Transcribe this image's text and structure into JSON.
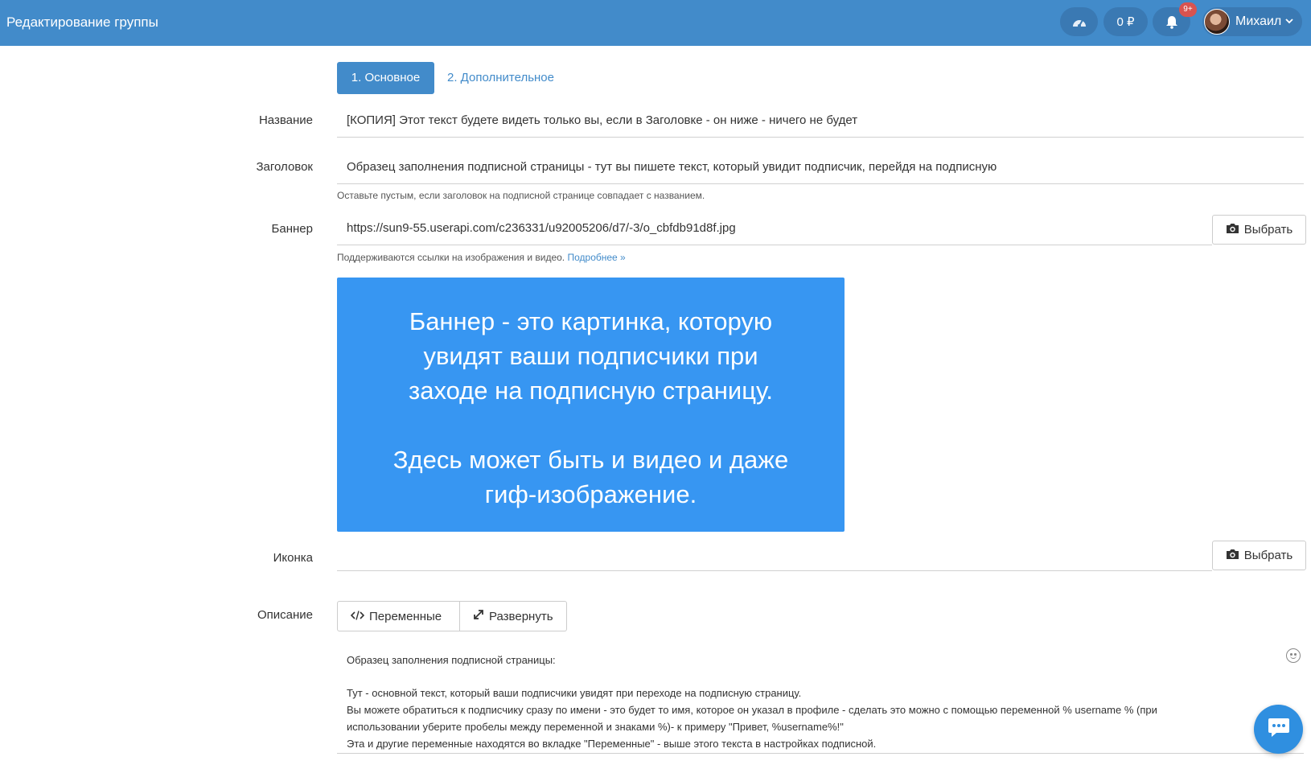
{
  "header": {
    "title": "Редактирование группы",
    "balance": "0 ₽",
    "notifications_badge": "9+",
    "user_name": "Михаил",
    "accent": "#428bca"
  },
  "tabs": [
    {
      "label": "1. Основное",
      "active": true
    },
    {
      "label": "2. Дополнительное",
      "active": false
    }
  ],
  "form": {
    "name": {
      "label": "Название",
      "value": "[КОПИЯ] Этот текст будете видеть только вы, если в Заголовке - он ниже - ничего не будет"
    },
    "heading": {
      "label": "Заголовок",
      "value": "Образец заполнения подписной страницы - тут вы пишете текст, который увидит подписчик, перейдя на подписную",
      "help": "Оставьте пустым, если заголовок на подписной странице совпадает с названием."
    },
    "banner": {
      "label": "Баннер",
      "value": "https://sun9-55.userapi.com/c236331/u92005206/d7/-3/o_cbfdb91d8f.jpg",
      "help": "Поддерживаются ссылки на изображения и видео.",
      "help_link": "Подробнее »",
      "button": "Выбрать"
    },
    "banner_preview": {
      "line1": "Баннер - это картинка, которую",
      "line2": "увидят ваши подписчики при",
      "line3": "заходе на подписную страницу.",
      "line4": "Здесь может быть и видео и даже",
      "line5": "гиф-изображение.",
      "color": "#3796f2"
    },
    "icon": {
      "label": "Иконка",
      "value": "",
      "button": "Выбрать"
    },
    "description": {
      "label": "Описание",
      "variables_button": "Переменные",
      "expand_button": "Развернуть",
      "text_line1": "Образец заполнения подписной страницы:",
      "text_line2": "Тут - основной текст, который ваши подписчики увидят при переходе на подписную страницу.",
      "text_line3": "Вы можете обратиться к подписчику сразу по имени - это будет то имя, которое он указал в профиле - сделать это можно с помощью переменной % username % (при",
      "text_line4": "использовании уберите пробелы между переменной и знаками %)- к примеру \"Привет, %username%!\"",
      "text_line5": "Эта и другие переменные находятся во вкладке \"Переменные\" - выше этого текста в настройках подписной."
    }
  }
}
